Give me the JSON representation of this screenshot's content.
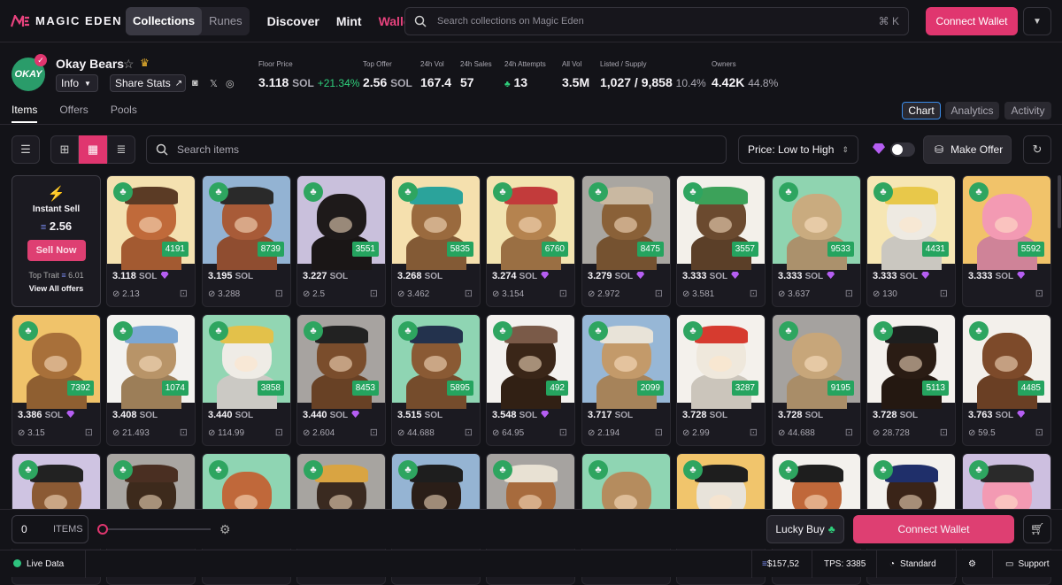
{
  "header": {
    "logo_text": "MAGIC EDEN",
    "seg": [
      "Collections",
      "Runes"
    ],
    "nav": [
      "Discover",
      "Mint",
      "Wallet"
    ],
    "search_placeholder": "Search collections on Magic Eden",
    "shortcut": "⌘ K",
    "connect": "Connect Wallet",
    "menu_icon": "chevron-down-icon"
  },
  "collection": {
    "avatar_text": "OKAY",
    "name": "Okay Bears",
    "info": "Info",
    "share": "Share Stats"
  },
  "stats": [
    {
      "label": "Floor Price",
      "value": "3.118",
      "unit": "SOL",
      "delta": "+21.34%"
    },
    {
      "label": "Top Offer",
      "value": "2.56",
      "unit": "SOL"
    },
    {
      "label": "24h Vol",
      "value": "167.4"
    },
    {
      "label": "24h Sales",
      "value": "57"
    },
    {
      "label": "24h Attempts",
      "value": "13"
    },
    {
      "label": "All Vol",
      "value": "3.5M"
    },
    {
      "label": "Listed / Supply",
      "value": "1,027 / 9,858",
      "pct": "10.4%"
    },
    {
      "label": "Owners",
      "value": "4.42K",
      "pct": "44.8%"
    }
  ],
  "tabs": [
    "Items",
    "Offers",
    "Pools"
  ],
  "view_tabs": [
    "Chart",
    "Analytics",
    "Activity"
  ],
  "toolbar": {
    "search_placeholder": "Search items",
    "sort": "Price: Low to High",
    "make_offer": "Make Offer"
  },
  "instant": {
    "title": "Instant Sell",
    "value": "2.56",
    "sell": "Sell Now",
    "top_trait_label": "Top Trait",
    "top_trait_value": "6.01",
    "view_all": "View All offers"
  },
  "cards": [
    {
      "id": "4191",
      "price": "3.118",
      "gem": true,
      "last": "2.13",
      "bg": "#f4e1b0",
      "fur": "#c06a3a",
      "hat": "#5b3b25"
    },
    {
      "id": "8739",
      "price": "3.195",
      "gem": false,
      "last": "3.288",
      "bg": "#93b3d3",
      "fur": "#a85b38",
      "hat": "#2a2a2a"
    },
    {
      "id": "3551",
      "price": "3.227",
      "gem": false,
      "last": "2.5",
      "bg": "#c9c0dc",
      "fur": "#1e1a1a",
      "hat": ""
    },
    {
      "id": "5835",
      "price": "3.268",
      "gem": false,
      "last": "3.462",
      "bg": "#f5e0ae",
      "fur": "#9a6a3e",
      "hat": "#2ba39b"
    },
    {
      "id": "6760",
      "price": "3.274",
      "gem": true,
      "last": "3.154",
      "bg": "#f2e3b0",
      "fur": "#b5834f",
      "hat": "#c23b3b"
    },
    {
      "id": "8475",
      "price": "3.279",
      "gem": true,
      "last": "2.972",
      "bg": "#a9a6a1",
      "fur": "#8a6138",
      "hat": "#c9b8a1"
    },
    {
      "id": "3557",
      "price": "3.333",
      "gem": true,
      "last": "3.581",
      "bg": "#f3f0ea",
      "fur": "#6b4a2f",
      "hat": "#3ca25a"
    },
    {
      "id": "9533",
      "price": "3.333",
      "gem": true,
      "last": "3.637",
      "bg": "#8fd4b0",
      "fur": "#c9ab7f",
      "hat": ""
    },
    {
      "id": "4431",
      "price": "3.333",
      "gem": true,
      "last": "130",
      "bg": "#f6e6b4",
      "fur": "#eeeae2",
      "hat": "#e8c84a"
    },
    {
      "id": "5592",
      "price": "3.333",
      "gem": true,
      "last": "",
      "bg": "#f1c36a",
      "fur": "#f39ab3",
      "hat": ""
    },
    {
      "id": "7392",
      "price": "3.386",
      "gem": true,
      "last": "3.15",
      "bg": "#f0c36a",
      "fur": "#a8703a",
      "hat": ""
    },
    {
      "id": "1074",
      "price": "3.408",
      "gem": false,
      "last": "21.493",
      "bg": "#f3f2ef",
      "fur": "#b89468",
      "hat": "#7da7d2"
    },
    {
      "id": "3858",
      "price": "3.440",
      "gem": false,
      "last": "114.99",
      "bg": "#92d6b3",
      "fur": "#efece6",
      "hat": "#e3c14a"
    },
    {
      "id": "8453",
      "price": "3.440",
      "gem": true,
      "last": "2.604",
      "bg": "#a7a3a0",
      "fur": "#7a4d2c",
      "hat": "#222"
    },
    {
      "id": "5895",
      "price": "3.515",
      "gem": false,
      "last": "44.688",
      "bg": "#8fd5b3",
      "fur": "#8a5a34",
      "hat": "#23324d"
    },
    {
      "id": "492",
      "price": "3.548",
      "gem": true,
      "last": "64.95",
      "bg": "#f3f1ee",
      "fur": "#3a2618",
      "hat": "#7a5a48"
    },
    {
      "id": "2099",
      "price": "3.717",
      "gem": false,
      "last": "2.194",
      "bg": "#97b7d6",
      "fur": "#c39a6a",
      "hat": "#e8e3d8"
    },
    {
      "id": "3287",
      "price": "3.728",
      "gem": false,
      "last": "2.99",
      "bg": "#f4f1ec",
      "fur": "#efe8dc",
      "hat": "#d63b2f"
    },
    {
      "id": "9195",
      "price": "3.728",
      "gem": false,
      "last": "44.688",
      "bg": "#a5a29f",
      "fur": "#c7a67a",
      "hat": ""
    },
    {
      "id": "5113",
      "price": "3.728",
      "gem": false,
      "last": "28.728",
      "bg": "#f4f1ed",
      "fur": "#2a1c14",
      "hat": "#1e1e1e"
    },
    {
      "id": "4485",
      "price": "3.763",
      "gem": true,
      "last": "59.5",
      "bg": "#f3f0eb",
      "fur": "#7d4a2a",
      "hat": ""
    },
    {
      "id": "",
      "price": "",
      "gem": false,
      "last": "",
      "bg": "#cfc4e2",
      "fur": "#8b5a34",
      "hat": "#222"
    },
    {
      "id": "",
      "price": "",
      "gem": false,
      "last": "",
      "bg": "#a9a6a2",
      "fur": "#3d2a1c",
      "hat": "#4a2f22"
    },
    {
      "id": "",
      "price": "",
      "gem": false,
      "last": "",
      "bg": "#8fd5b3",
      "fur": "#c0683a",
      "hat": ""
    },
    {
      "id": "",
      "price": "",
      "gem": false,
      "last": "",
      "bg": "#a7a4a0",
      "fur": "#3a2a20",
      "hat": "#d9a442"
    },
    {
      "id": "",
      "price": "",
      "gem": false,
      "last": "",
      "bg": "#95b4d3",
      "fur": "#2a1e18",
      "hat": "#1e1e1e"
    },
    {
      "id": "",
      "price": "",
      "gem": false,
      "last": "",
      "bg": "#a6a3a0",
      "fur": "#a76b3d",
      "hat": "#e8e1d3"
    },
    {
      "id": "",
      "price": "",
      "gem": false,
      "last": "",
      "bg": "#8fd5b3",
      "fur": "#b58c5e",
      "hat": ""
    },
    {
      "id": "",
      "price": "",
      "gem": false,
      "last": "",
      "bg": "#f1c56c",
      "fur": "#e8e3da",
      "hat": "#1e1e1e"
    },
    {
      "id": "",
      "price": "",
      "gem": false,
      "last": "",
      "bg": "#f3f1ed",
      "fur": "#c0683a",
      "hat": "#1e1e1e"
    },
    {
      "id": "",
      "price": "",
      "gem": false,
      "last": "",
      "bg": "#f3f1ed",
      "fur": "#3a2418",
      "hat": "#1f2f6a"
    },
    {
      "id": "",
      "price": "",
      "gem": false,
      "last": "",
      "bg": "#cdbfe0",
      "fur": "#f39ab3",
      "hat": "#2a2a2a"
    }
  ],
  "unit": "SOL",
  "footer": {
    "qty": "0",
    "items": "ITEMS",
    "lucky": "Lucky Buy",
    "connect": "Connect Wallet"
  },
  "status": {
    "live": "Live Data",
    "sol_price": "$157,52",
    "tps": "TPS: 3385",
    "standard": "Standard",
    "support": "Support"
  },
  "colors": {
    "accent": "#e0366f",
    "green": "#2fd07c",
    "gem": "#b55ef2"
  }
}
